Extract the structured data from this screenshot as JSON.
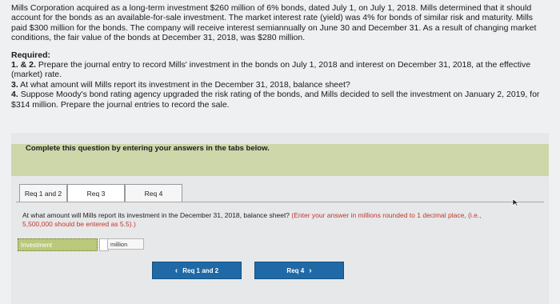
{
  "problem": {
    "intro": "Mills Corporation acquired as a long-term investment $260 million of 6% bonds, dated July 1, on July 1, 2018. Mills determined that it should account for the bonds as an available-for-sale investment. The market interest rate (yield) was 4% for bonds of similar risk and maturity. Mills paid $300 million for the bonds. The company will receive interest semiannually on June 30 and December 31. As a result of changing market conditions, the fair value of the bonds at December 31, 2018, was $280 million.",
    "required_heading": "Required:",
    "requirements": [
      {
        "num": "1. & 2.",
        "text": "Prepare the journal entry to record Mills' investment in the bonds on July 1, 2018 and interest on December 31, 2018, at the effective (market) rate."
      },
      {
        "num": "3.",
        "text": "At what amount will Mills report its investment in the December 31, 2018, balance sheet?"
      },
      {
        "num": "4.",
        "text": "Suppose Moody's bond rating agency upgraded the risk rating of the bonds, and Mills decided to sell the investment on January 2, 2019, for $314 million. Prepare the journal entries to record the sale."
      }
    ]
  },
  "instruction": "Complete this question by entering your answers in the tabs below.",
  "tabs": [
    {
      "label": "Req 1 and 2"
    },
    {
      "label": "Req 3"
    },
    {
      "label": "Req 4"
    }
  ],
  "question": {
    "text": "At what amount will Mills report its investment in the December 31, 2018, balance sheet?",
    "hint": "(Enter your answer in millions rounded to 1 decimal place, (i.e., 5,500,000 should be entered as 5.5).)"
  },
  "answer": {
    "label": "Investment",
    "value": "",
    "unit": "million"
  },
  "nav": {
    "prev_label": "Req 1 and 2",
    "next_label": "Req 4"
  },
  "colors": {
    "instruction_bar": "#cdd7aa",
    "nav_button": "#1f6aa6",
    "hint_text": "#c0392b"
  }
}
